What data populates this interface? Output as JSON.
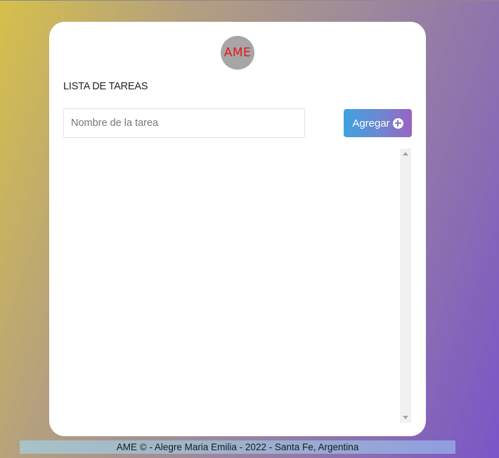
{
  "header": {
    "logo_text": "AME",
    "title": "LISTA DE TAREAS"
  },
  "form": {
    "input_value": "",
    "input_placeholder": "Nombre de la tarea",
    "add_label": "Agregar",
    "add_icon": "plus-circle-icon"
  },
  "task_list": {
    "items": []
  },
  "footer": {
    "text": "AME © - Alegre Maria Emilia - 2022 - Santa Fe, Argentina"
  },
  "colors": {
    "logo_bg": "#a6a6a6",
    "logo_text": "#e8141a",
    "button_gradient_start": "#3ea2e0",
    "button_gradient_end": "#9a63c0",
    "background_gradient_start": "#d6c04c",
    "background_gradient_end": "#7a55c8"
  }
}
